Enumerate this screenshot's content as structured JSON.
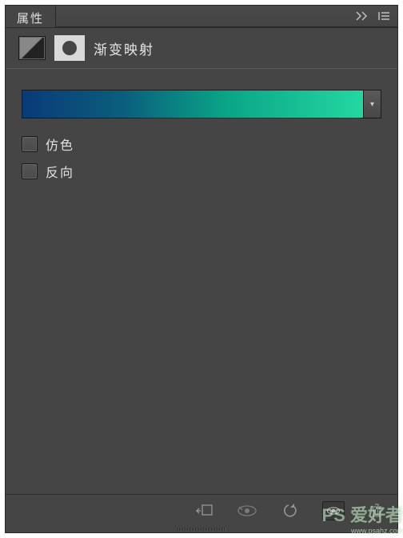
{
  "panel": {
    "tab_title": "属性",
    "adjustment_name": "渐变映射"
  },
  "gradient": {
    "dropdown_glyph": "▾",
    "stops": [
      "#0a3a78",
      "#0a5f7d",
      "#0aa587",
      "#24d7a1"
    ]
  },
  "checkboxes": {
    "dither_label": "仿色",
    "reverse_label": "反向"
  },
  "watermark": {
    "text": "PS 爱好者",
    "url": "www.psahz.com"
  }
}
